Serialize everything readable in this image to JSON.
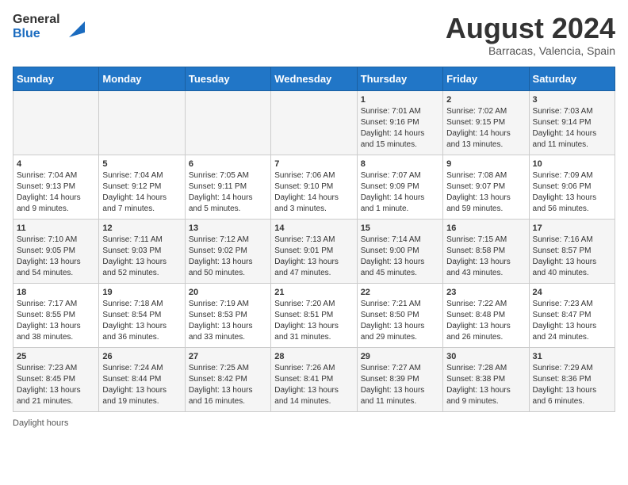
{
  "header": {
    "logo_line1": "General",
    "logo_line2": "Blue",
    "title": "August 2024",
    "subtitle": "Barracas, Valencia, Spain"
  },
  "calendar": {
    "days_of_week": [
      "Sunday",
      "Monday",
      "Tuesday",
      "Wednesday",
      "Thursday",
      "Friday",
      "Saturday"
    ],
    "weeks": [
      [
        {
          "day": "",
          "info": ""
        },
        {
          "day": "",
          "info": ""
        },
        {
          "day": "",
          "info": ""
        },
        {
          "day": "",
          "info": ""
        },
        {
          "day": "1",
          "info": "Sunrise: 7:01 AM\nSunset: 9:16 PM\nDaylight: 14 hours and 15 minutes."
        },
        {
          "day": "2",
          "info": "Sunrise: 7:02 AM\nSunset: 9:15 PM\nDaylight: 14 hours and 13 minutes."
        },
        {
          "day": "3",
          "info": "Sunrise: 7:03 AM\nSunset: 9:14 PM\nDaylight: 14 hours and 11 minutes."
        }
      ],
      [
        {
          "day": "4",
          "info": "Sunrise: 7:04 AM\nSunset: 9:13 PM\nDaylight: 14 hours and 9 minutes."
        },
        {
          "day": "5",
          "info": "Sunrise: 7:04 AM\nSunset: 9:12 PM\nDaylight: 14 hours and 7 minutes."
        },
        {
          "day": "6",
          "info": "Sunrise: 7:05 AM\nSunset: 9:11 PM\nDaylight: 14 hours and 5 minutes."
        },
        {
          "day": "7",
          "info": "Sunrise: 7:06 AM\nSunset: 9:10 PM\nDaylight: 14 hours and 3 minutes."
        },
        {
          "day": "8",
          "info": "Sunrise: 7:07 AM\nSunset: 9:09 PM\nDaylight: 14 hours and 1 minute."
        },
        {
          "day": "9",
          "info": "Sunrise: 7:08 AM\nSunset: 9:07 PM\nDaylight: 13 hours and 59 minutes."
        },
        {
          "day": "10",
          "info": "Sunrise: 7:09 AM\nSunset: 9:06 PM\nDaylight: 13 hours and 56 minutes."
        }
      ],
      [
        {
          "day": "11",
          "info": "Sunrise: 7:10 AM\nSunset: 9:05 PM\nDaylight: 13 hours and 54 minutes."
        },
        {
          "day": "12",
          "info": "Sunrise: 7:11 AM\nSunset: 9:03 PM\nDaylight: 13 hours and 52 minutes."
        },
        {
          "day": "13",
          "info": "Sunrise: 7:12 AM\nSunset: 9:02 PM\nDaylight: 13 hours and 50 minutes."
        },
        {
          "day": "14",
          "info": "Sunrise: 7:13 AM\nSunset: 9:01 PM\nDaylight: 13 hours and 47 minutes."
        },
        {
          "day": "15",
          "info": "Sunrise: 7:14 AM\nSunset: 9:00 PM\nDaylight: 13 hours and 45 minutes."
        },
        {
          "day": "16",
          "info": "Sunrise: 7:15 AM\nSunset: 8:58 PM\nDaylight: 13 hours and 43 minutes."
        },
        {
          "day": "17",
          "info": "Sunrise: 7:16 AM\nSunset: 8:57 PM\nDaylight: 13 hours and 40 minutes."
        }
      ],
      [
        {
          "day": "18",
          "info": "Sunrise: 7:17 AM\nSunset: 8:55 PM\nDaylight: 13 hours and 38 minutes."
        },
        {
          "day": "19",
          "info": "Sunrise: 7:18 AM\nSunset: 8:54 PM\nDaylight: 13 hours and 36 minutes."
        },
        {
          "day": "20",
          "info": "Sunrise: 7:19 AM\nSunset: 8:53 PM\nDaylight: 13 hours and 33 minutes."
        },
        {
          "day": "21",
          "info": "Sunrise: 7:20 AM\nSunset: 8:51 PM\nDaylight: 13 hours and 31 minutes."
        },
        {
          "day": "22",
          "info": "Sunrise: 7:21 AM\nSunset: 8:50 PM\nDaylight: 13 hours and 29 minutes."
        },
        {
          "day": "23",
          "info": "Sunrise: 7:22 AM\nSunset: 8:48 PM\nDaylight: 13 hours and 26 minutes."
        },
        {
          "day": "24",
          "info": "Sunrise: 7:23 AM\nSunset: 8:47 PM\nDaylight: 13 hours and 24 minutes."
        }
      ],
      [
        {
          "day": "25",
          "info": "Sunrise: 7:23 AM\nSunset: 8:45 PM\nDaylight: 13 hours and 21 minutes."
        },
        {
          "day": "26",
          "info": "Sunrise: 7:24 AM\nSunset: 8:44 PM\nDaylight: 13 hours and 19 minutes."
        },
        {
          "day": "27",
          "info": "Sunrise: 7:25 AM\nSunset: 8:42 PM\nDaylight: 13 hours and 16 minutes."
        },
        {
          "day": "28",
          "info": "Sunrise: 7:26 AM\nSunset: 8:41 PM\nDaylight: 13 hours and 14 minutes."
        },
        {
          "day": "29",
          "info": "Sunrise: 7:27 AM\nSunset: 8:39 PM\nDaylight: 13 hours and 11 minutes."
        },
        {
          "day": "30",
          "info": "Sunrise: 7:28 AM\nSunset: 8:38 PM\nDaylight: 13 hours and 9 minutes."
        },
        {
          "day": "31",
          "info": "Sunrise: 7:29 AM\nSunset: 8:36 PM\nDaylight: 13 hours and 6 minutes."
        }
      ]
    ]
  },
  "footer": {
    "note": "Daylight hours"
  }
}
